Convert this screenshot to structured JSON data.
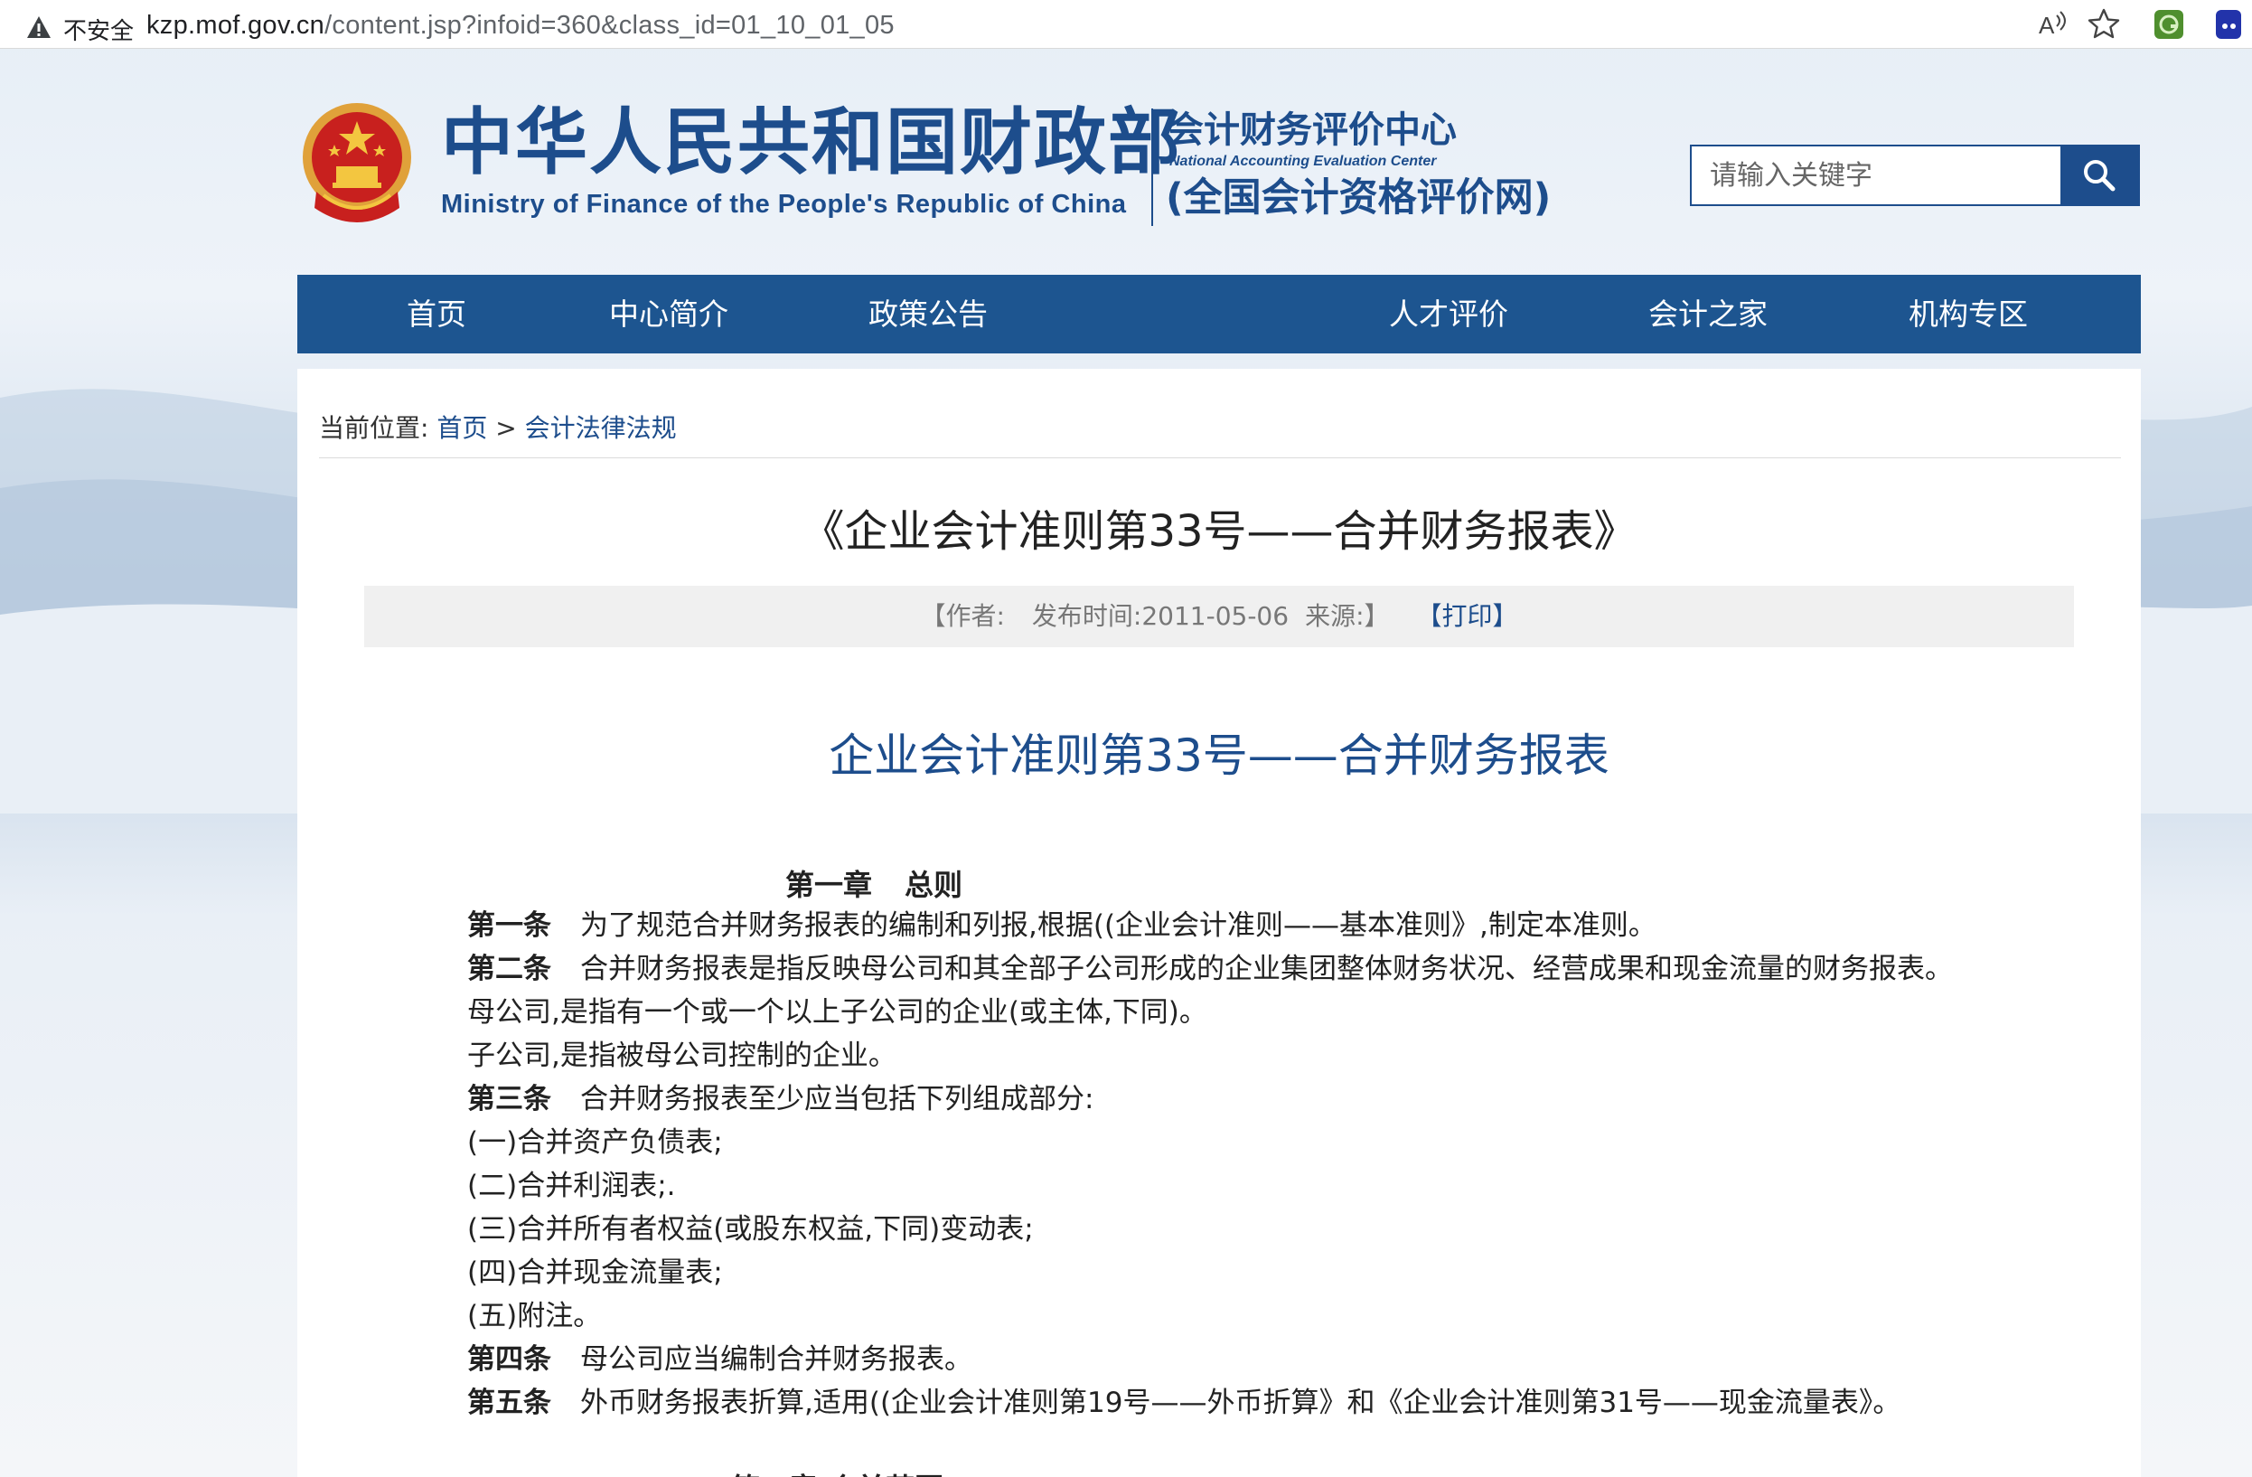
{
  "browser": {
    "security_label": "不安全",
    "url_host": "kzp.mof.gov.cn",
    "url_path": "/content.jsp?infoid=360&class_id=01_10_01_05"
  },
  "header": {
    "title_cn": "中华人民共和国财政部",
    "title_en": "Ministry of Finance of the People's Republic of China",
    "center_cn": "会计财务评价中心",
    "center_en": "National Accounting Evaluation Center",
    "center_sub": "(全国会计资格评价网)",
    "brand_color": "#1d4d8c"
  },
  "search": {
    "placeholder": "请输入关键字"
  },
  "nav": {
    "items": [
      "首页",
      "中心简介",
      "政策公告",
      "人才评价",
      "会计之家",
      "机构专区"
    ]
  },
  "breadcrumb": {
    "prefix": "当前位置:",
    "home": "首页",
    "sep": ">",
    "current": "会计法律法规"
  },
  "article": {
    "title": "《企业会计准则第33号——合并财务报表》",
    "meta_author": "【作者:",
    "meta_date": "发布时间:2011-05-06",
    "meta_source": "来源:】",
    "print_label": "【打印】",
    "doc_title": "企业会计准则第33号——合并财务报表",
    "chapter_num": "第一章",
    "chapter_name": "总则",
    "lines": [
      {
        "label": "第一条",
        "text": "为了规范合并财务报表的编制和列报,根据((企业会计准则——基本准则》,制定本准则。"
      },
      {
        "label": "第二条",
        "text": "合并财务报表是指反映母公司和其全部子公司形成的企业集团整体财务状况、经营成果和现金流量的财务报表。"
      },
      {
        "label": "",
        "text": "母公司,是指有一个或一个以上子公司的企业(或主体,下同)。"
      },
      {
        "label": "",
        "text": "子公司,是指被母公司控制的企业。"
      },
      {
        "label": "第三条",
        "text": "合并财务报表至少应当包括下列组成部分:"
      },
      {
        "label": "",
        "text": "(一)合并资产负债表;"
      },
      {
        "label": "",
        "text": "(二)合并利润表;."
      },
      {
        "label": "",
        "text": "(三)合并所有者权益(或股东权益,下同)变动表;"
      },
      {
        "label": "",
        "text": "(四)合并现金流量表;"
      },
      {
        "label": "",
        "text": "(五)附注。"
      },
      {
        "label": "第四条",
        "text": "母公司应当编制合并财务报表。"
      },
      {
        "label": "第五条",
        "text": "外币财务报表折算,适用((企业会计准则第19号——外币折算》和《企业会计准则第31号——现金流量表》。"
      }
    ],
    "next_heading_partial": "第二章 合并范围"
  }
}
